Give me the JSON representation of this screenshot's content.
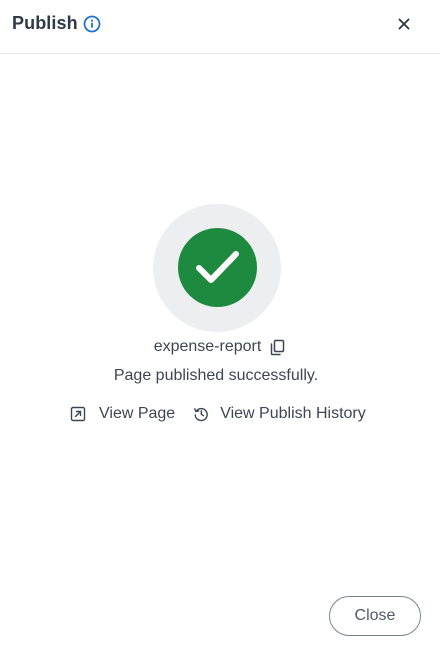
{
  "dialog": {
    "title": "Publish",
    "info_icon": "info-icon",
    "close_icon": "close-icon"
  },
  "status": {
    "icon": "check-circle-icon",
    "accent_color": "#1e8a3f",
    "ring_color": "#eceeef",
    "page_name": "expense-report",
    "copy_icon": "copy-icon",
    "message": "Page published successfully."
  },
  "links": {
    "view_page": {
      "label": "View Page",
      "icon": "external-link-icon"
    },
    "view_history": {
      "label": "View Publish History",
      "icon": "history-icon"
    }
  },
  "footer": {
    "close_label": "Close"
  },
  "colors": {
    "info_blue": "#1f74d1",
    "text": "#3c4653"
  }
}
